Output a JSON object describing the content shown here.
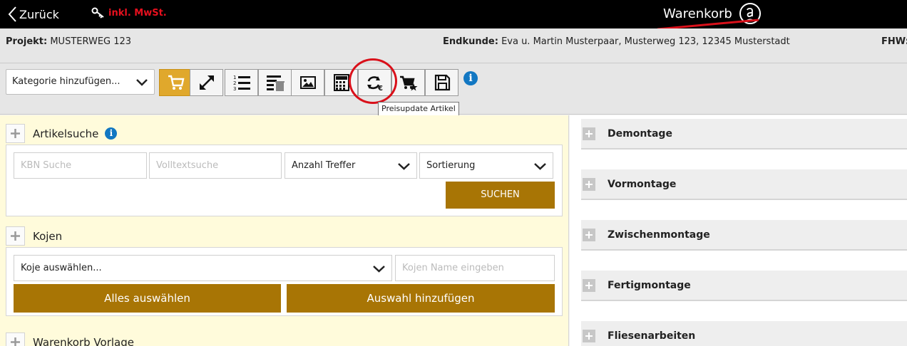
{
  "topbar": {
    "back_label": "Zurück",
    "tax_label": "inkl. MwSt.",
    "cart_title": "Warenkorb",
    "accent_color": "#e8101e"
  },
  "info": {
    "project_label": "Projekt:",
    "project_value": "MUSTERWEG 123",
    "customer_label": "Endkunde:",
    "customer_value": "Eva u. Martin Musterpaar, Musterweg 123, 12345 Musterstadt",
    "fhw_label": "FHW:"
  },
  "toolbar": {
    "category_select": "Kategorie hinzufügen...",
    "buttons": [
      {
        "icon": "add-to-cart-icon"
      },
      {
        "icon": "expand-icon"
      },
      {
        "icon": "numbered-list-icon"
      },
      {
        "icon": "clear-list-icon"
      },
      {
        "icon": "image-icon"
      },
      {
        "icon": "calculator-icon"
      },
      {
        "icon": "price-update-icon"
      },
      {
        "icon": "favorite-cart-icon"
      },
      {
        "icon": "save-icon"
      }
    ],
    "tooltip": "Preisupdate Artikel"
  },
  "article_search": {
    "title": "Artikelsuche",
    "kbn_placeholder": "KBN Suche",
    "fulltext_placeholder": "Volltextsuche",
    "hits_select": "Anzahl Treffer",
    "sort_select": "Sortierung",
    "search_button": "SUCHEN"
  },
  "booths": {
    "title": "Kojen",
    "booth_select": "Koje auswählen...",
    "booth_name_placeholder": "Kojen Name eingeben",
    "select_all_button": "Alles auswählen",
    "add_selection_button": "Auswahl hinzufügen"
  },
  "template": {
    "title": "Warenkorb Vorlage"
  },
  "categories": [
    {
      "label": "Demontage"
    },
    {
      "label": "Vormontage"
    },
    {
      "label": "Zwischenmontage"
    },
    {
      "label": "Fertigmontage"
    },
    {
      "label": "Fliesenarbeiten"
    }
  ],
  "colors": {
    "gold_button": "#a87505",
    "cart_button": "#e0a82c",
    "left_panel_bg": "#fffbdb",
    "info_blue": "#1277c2",
    "annotation_red": "#d9101a"
  }
}
